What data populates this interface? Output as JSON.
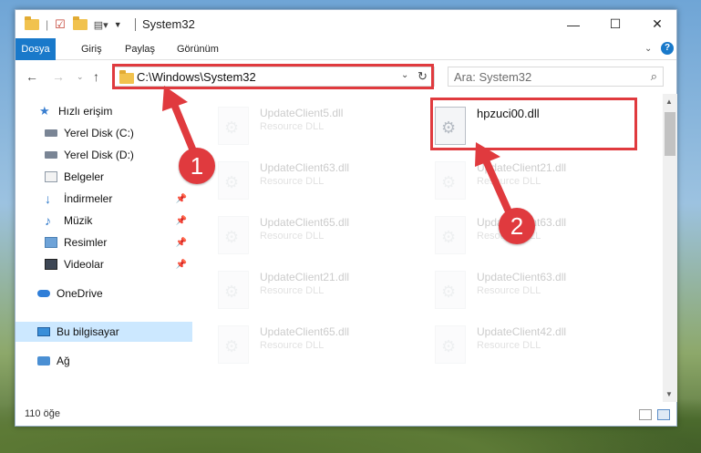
{
  "window": {
    "title": "System32",
    "controls": {
      "minimize": "—",
      "maximize": "☐",
      "close": "✕"
    }
  },
  "ribbon": {
    "tabs": [
      "Dosya",
      "Giriş",
      "Paylaş",
      "Görünüm"
    ]
  },
  "address": {
    "path": "C:\\Windows\\System32",
    "search_placeholder": "Ara: System32"
  },
  "nav": {
    "items": [
      {
        "label": "Hızlı erişim",
        "icon": "star-icon"
      },
      {
        "label": "Yerel Disk (C:)",
        "icon": "drive-icon"
      },
      {
        "label": "Yerel Disk (D:)",
        "icon": "drive-icon"
      },
      {
        "label": "Belgeler",
        "icon": "documents-icon"
      },
      {
        "label": "İndirmeler",
        "icon": "download-icon"
      },
      {
        "label": "Müzik",
        "icon": "music-icon"
      },
      {
        "label": "Resimler",
        "icon": "pictures-icon"
      },
      {
        "label": "Videolar",
        "icon": "video-icon"
      },
      {
        "label": "OneDrive",
        "icon": "cloud-icon"
      },
      {
        "label": "Bu bilgisayar",
        "icon": "computer-icon"
      },
      {
        "label": "Ağ",
        "icon": "network-icon"
      }
    ]
  },
  "files": {
    "col1": [
      {
        "name": "UpdateClient5.dll",
        "type": "Resource DLL"
      },
      {
        "name": "UpdateClient63.dll",
        "type": "Resource DLL"
      },
      {
        "name": "UpdateClient65.dll",
        "type": "Resource DLL"
      },
      {
        "name": "UpdateClient21.dll",
        "type": "Resource DLL"
      },
      {
        "name": "UpdateClient65.dll",
        "type": "Resource DLL"
      }
    ],
    "col2": [
      {
        "name": "hpzuci00.dll",
        "type": ""
      },
      {
        "name": "UpdateClient21.dll",
        "type": "Resource DLL"
      },
      {
        "name": "UpdateClient63.dll",
        "type": "Resource DLL"
      },
      {
        "name": "UpdateClient63.dll",
        "type": "Resource DLL"
      },
      {
        "name": "UpdateClient42.dll",
        "type": "Resource DLL"
      }
    ]
  },
  "status": {
    "count": "110 öğe"
  },
  "annotations": {
    "badge1": "1",
    "badge2": "2"
  },
  "colors": {
    "accent": "#1979ca",
    "highlight": "#e03a3e",
    "selected": "#cce8ff"
  }
}
